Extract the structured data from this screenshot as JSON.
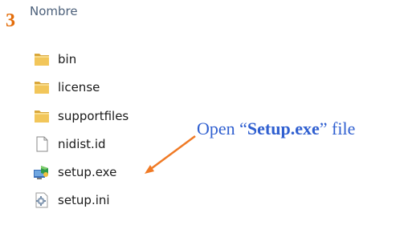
{
  "step_number": "3",
  "column_header": "Nombre",
  "files": [
    {
      "name": "bin",
      "icon": "folder-icon"
    },
    {
      "name": "license",
      "icon": "folder-icon"
    },
    {
      "name": "supportfiles",
      "icon": "folder-icon"
    },
    {
      "name": "nidist.id",
      "icon": "file-icon"
    },
    {
      "name": "setup.exe",
      "icon": "setup-exe-icon"
    },
    {
      "name": "setup.ini",
      "icon": "settings-file-icon"
    }
  ],
  "annotation": {
    "prefix": "Open “",
    "bold": "Setup.exe",
    "suffix": "” file"
  },
  "colors": {
    "annotation_text": "#2f5fd0",
    "arrow": "#f07a25",
    "step_number": "#e36c09",
    "folder": "#e8b84a"
  }
}
